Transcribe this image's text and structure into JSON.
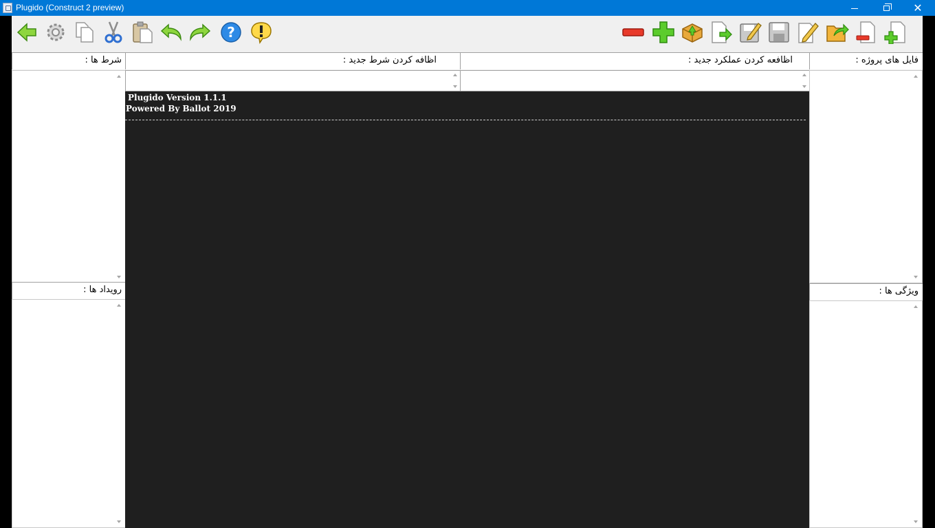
{
  "window": {
    "title": "Plugido (Construct 2 preview)",
    "controls": {
      "minimize": "minimize-icon",
      "maximize": "restore-icon",
      "close": "close-icon"
    }
  },
  "toolbar": {
    "left_icons": [
      "back-arrow-icon",
      "gear-icon",
      "copy-icon",
      "scissors-icon",
      "paste-icon",
      "undo-icon",
      "redo-icon",
      "help-icon",
      "warning-icon"
    ],
    "right_icons": [
      "remove-icon",
      "add-icon",
      "package-icon",
      "export-icon",
      "edit-save-icon",
      "save-icon",
      "pencil-icon",
      "open-folder-icon",
      "remove-file-icon",
      "add-file-icon"
    ]
  },
  "panels": {
    "conditions_label": "شرط ها :",
    "add_condition_label": "اظافه کردن شرط جدید :",
    "add_action_label": "اظافعه کردن عملکرد جدید :",
    "project_files_label": "فایل های پروژه :",
    "events_label": "رویداد ها :",
    "properties_label": "ویژگی ها :"
  },
  "console": {
    "line1": "Plugido Version 1.1.1",
    "line2": "Powered By Ballot 2019"
  },
  "colors": {
    "titlebar": "#0078d7",
    "console_bg": "#1f1f1f"
  }
}
